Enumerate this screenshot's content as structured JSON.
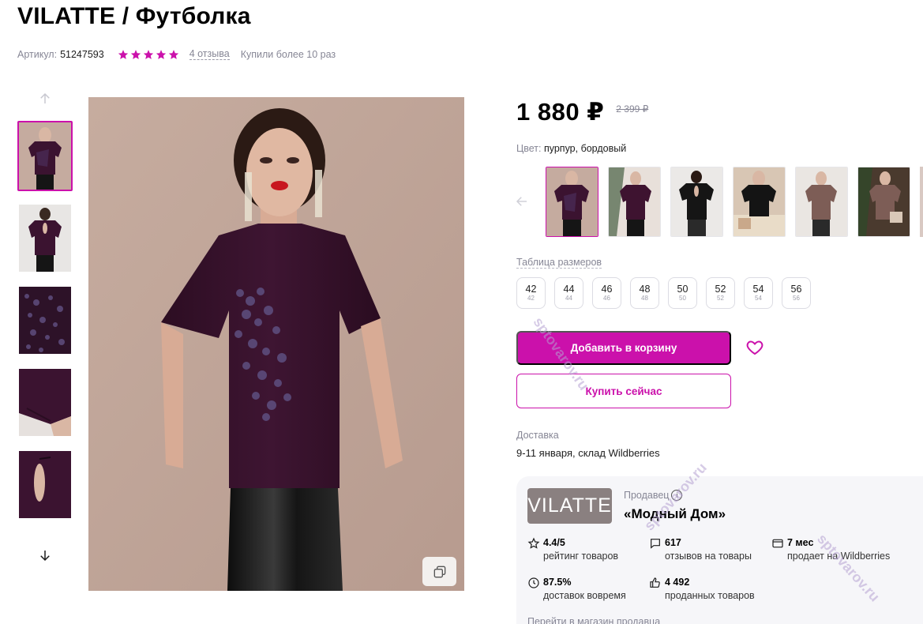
{
  "product": {
    "title": "VILATTE / Футболка",
    "article_label": "Артикул:",
    "article_value": "51247593",
    "rating_stars": 5,
    "reviews": "4 отзыва",
    "bought": "Купили более 10 раз"
  },
  "price": {
    "current": "1 880 ₽",
    "old": "2 399 ₽"
  },
  "color": {
    "label": "Цвет:",
    "value": "пурпур, бордовый"
  },
  "sizes": {
    "table_label": "Таблица размеров",
    "items": [
      {
        "size": "42",
        "ru": "42"
      },
      {
        "size": "44",
        "ru": "44"
      },
      {
        "size": "46",
        "ru": "46"
      },
      {
        "size": "48",
        "ru": "48"
      },
      {
        "size": "50",
        "ru": "50"
      },
      {
        "size": "52",
        "ru": "52"
      },
      {
        "size": "54",
        "ru": "54"
      },
      {
        "size": "56",
        "ru": "56"
      }
    ]
  },
  "actions": {
    "add_to_cart": "Добавить в корзину",
    "buy_now": "Купить сейчас"
  },
  "delivery": {
    "label": "Доставка",
    "value": "9-11 января, склад Wildberries"
  },
  "seller": {
    "logo_text": "VILATTE",
    "label": "Продавец",
    "name": "«Модный Дом»",
    "stats": {
      "rating_value": "4.4/5",
      "rating_label": "рейтинг товаров",
      "reviews_value": "617",
      "reviews_label": "отзывов на товары",
      "months_value": "7 мес",
      "months_label": "продает на Wildberries",
      "ontime_value": "87.5%",
      "ontime_label": "доставок вовремя",
      "sold_value": "4 492",
      "sold_label": "проданных товаров"
    },
    "link": "Перейти в магазин продавца"
  },
  "watermarks": [
    "sptovarov.ru",
    "sptovarov.ru",
    "sptovarov.ru"
  ],
  "colors": {
    "accent": "#cb11ab",
    "muted_text": "#868695",
    "card_bg": "#f6f6f9"
  }
}
